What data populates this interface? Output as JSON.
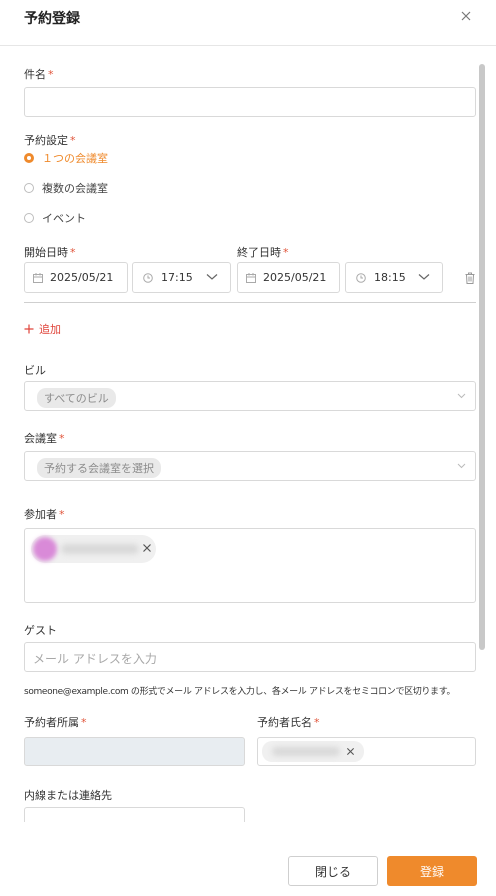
{
  "dialog": {
    "title": "予約登録"
  },
  "subject": {
    "label": "件名",
    "value": ""
  },
  "reservation_setting": {
    "label": "予約設定",
    "options": [
      {
        "label": "１つの会議室",
        "selected": true
      },
      {
        "label": "複数の会議室",
        "selected": false
      },
      {
        "label": "イベント",
        "selected": false
      }
    ]
  },
  "start": {
    "label": "開始日時",
    "date": "2025/05/21",
    "time": "17:15"
  },
  "end": {
    "label": "終了日時",
    "date": "2025/05/21",
    "time": "18:15"
  },
  "add_label": "追加",
  "building": {
    "label": "ビル",
    "value": "すべてのビル"
  },
  "room": {
    "label": "会議室",
    "value": "予約する会議室を選択"
  },
  "participants": {
    "label": "参加者"
  },
  "guest": {
    "label": "ゲスト",
    "placeholder": "メール アドレスを入力",
    "hint": "someone@example.com の形式でメール アドレスを入力し、各メール アドレスをセミコロンで区切ります。"
  },
  "booker_affiliation": {
    "label": "予約者所属",
    "value": ""
  },
  "booker_name": {
    "label": "予約者氏名"
  },
  "extension": {
    "label": "内線または連絡先",
    "value": ""
  },
  "footer": {
    "close_label": "閉じる",
    "submit_label": "登録"
  },
  "colors": {
    "accent": "#ef8a2c",
    "required": "#e0543a",
    "add": "#e0443a"
  },
  "icons": [
    "close-icon",
    "calendar-icon",
    "clock-icon",
    "chevron-down-icon",
    "trash-icon",
    "plus-icon"
  ]
}
